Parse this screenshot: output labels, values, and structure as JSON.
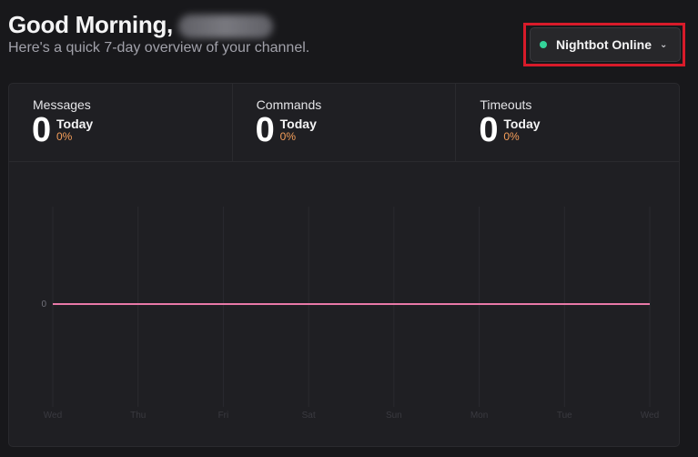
{
  "header": {
    "greeting": "Good Morning,",
    "subtitle": "Here's a quick 7-day overview of your channel."
  },
  "bot_status": {
    "label": "Nightbot Online",
    "status_color": "#34d399",
    "icon": "chevron-down-icon"
  },
  "stats": [
    {
      "label": "Messages",
      "value": "0",
      "period": "Today",
      "change": "0%"
    },
    {
      "label": "Commands",
      "value": "0",
      "period": "Today",
      "change": "0%"
    },
    {
      "label": "Timeouts",
      "value": "0",
      "period": "Today",
      "change": "0%"
    }
  ],
  "chart_data": {
    "type": "line",
    "x": [
      "Wed",
      "Thu",
      "Fri",
      "Sat",
      "Sun",
      "Mon",
      "Tue",
      "Wed"
    ],
    "series": [
      {
        "values": [
          0,
          0,
          0,
          0,
          0,
          0,
          0,
          0
        ],
        "color": "#e879a8"
      }
    ],
    "y_ticks": [
      "0"
    ],
    "title": "",
    "xlabel": "",
    "ylabel": "",
    "grid": true
  }
}
